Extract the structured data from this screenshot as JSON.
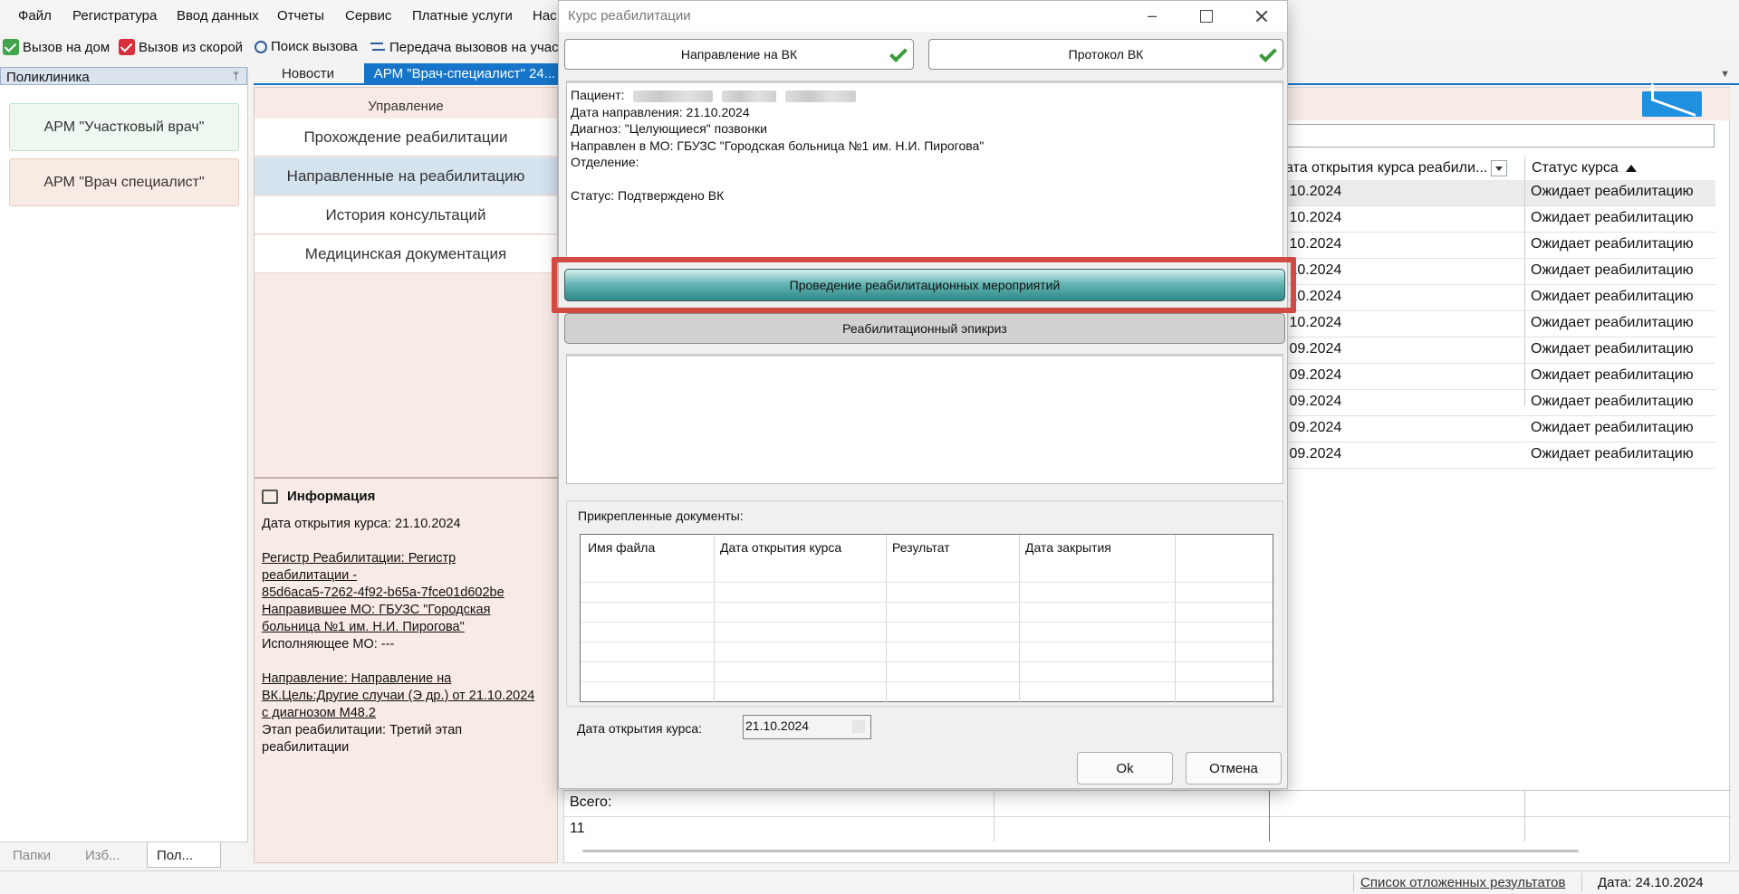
{
  "menu": [
    "Файл",
    "Регистратура",
    "Ввод данных",
    "Отчеты",
    "Сервис",
    "Платные услуги",
    "Нас"
  ],
  "toolbar": {
    "home_call": "Вызов на дом",
    "ambulance_call": "Вызов из скорой",
    "search_call": "Поиск вызова",
    "transfer_calls": "Передача вызовов на учас"
  },
  "left_panel": {
    "header": "Поликлиника",
    "arm_district": "АРМ \"Участковый врач\"",
    "arm_specialist": "АРМ \"Врач специалист\"",
    "tabs": [
      "Папки",
      "Изб...",
      "Пол..."
    ]
  },
  "doc_tabs": [
    "Новости",
    "АРМ \"Врач-специалист\" 24..."
  ],
  "management": {
    "title": "Управление",
    "items": [
      "Прохождение реабилитации",
      "Направленные на реабилитацию",
      "История консультаций",
      "Медицинская документация"
    ]
  },
  "info": {
    "title": "Информация",
    "open_date": "Дата открытия курса: 21.10.2024",
    "registry_1": "Регистр Реабилитации: Регистр",
    "registry_2": "реабилитации -",
    "registry_3": "85d6aca5-7262-4f92-b65a-7fce01d602be",
    "sending_mo_1": "Направившее МО: ГБУЗС \"Городская",
    "sending_mo_2": "больница №1 им. Н.И. Пирогова\"",
    "executing_mo": "Исполняющее МО: ---",
    "direction_1": "Направление: Направление на",
    "direction_2": "ВК.Цель:Другие случаи (Э др.) от 21.10.2024",
    "direction_3": "с диагнозом М48.2",
    "stage_1": "Этап реабилитации: Третий этап",
    "stage_2": "реабилитации"
  },
  "grid": {
    "col_open_date": "ата открытия курса реабили...",
    "col_status": "Статус курса",
    "rows": [
      {
        "date": ".10.2024",
        "status": "Ожидает реабилитацию"
      },
      {
        "date": ".10.2024",
        "status": "Ожидает реабилитацию"
      },
      {
        "date": ".10.2024",
        "status": "Ожидает реабилитацию"
      },
      {
        "date": ".10.2024",
        "status": "Ожидает реабилитацию"
      },
      {
        "date": ".10.2024",
        "status": "Ожидает реабилитацию"
      },
      {
        "date": ".10.2024",
        "status": "Ожидает реабилитацию"
      },
      {
        "date": ".09.2024",
        "status": "Ожидает реабилитацию"
      },
      {
        "date": ".09.2024",
        "status": "Ожидает реабилитацию"
      },
      {
        "date": ".09.2024",
        "status": "Ожидает реабилитацию"
      },
      {
        "date": ".09.2024",
        "status": "Ожидает реабилитацию"
      },
      {
        "date": ".09.2024",
        "status": "Ожидает реабилитацию"
      }
    ],
    "total_label": "Всего:",
    "total_value": "11"
  },
  "statusbar": {
    "deferred_results": "Список отложенных результатов",
    "date": "Дата: 24.10.2024"
  },
  "modal": {
    "title": "Курс реабилитации",
    "btn_vk_direction": "Направление на ВК",
    "btn_vk_protocol": "Протокол ВК",
    "patient_label": "Пациент:",
    "referral_date": "Дата направления: 21.10.2024",
    "diagnosis": "Диагноз: \"Целующиеся\" позвонки",
    "sent_to_mo": "Направлен в МО: ГБУЗС \"Городская больница №1 им. Н.И. Пирогова\"",
    "department": "Отделение:",
    "status": "Статус: Подтверждено ВК",
    "btn_conduct": "Проведение реабилитационных мероприятий",
    "btn_epicrisis": "Реабилитационный эпикриз",
    "attached_label": "Прикрепленные документы:",
    "doc_columns": [
      "Имя файла",
      "Дата открытия курса",
      "Результат",
      "Дата закрытия"
    ],
    "open_date_label": "Дата открытия курса:",
    "open_date_value": "21.10.2024",
    "ok": "Ok",
    "cancel": "Отмена"
  },
  "colors": {
    "accent_blue": "#1675c8",
    "highlight_red": "#d24b43",
    "teal_button": "#2f8886"
  }
}
